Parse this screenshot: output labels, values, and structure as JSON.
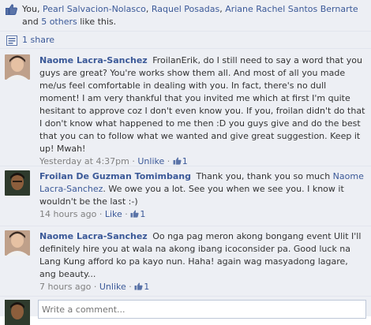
{
  "likes": {
    "prefix": "You, ",
    "name1": "Pearl Salvacion-Nolasco",
    "sep1": ", ",
    "name2": "Raquel Posadas",
    "sep2": ", ",
    "name3": "Ariane Rachel Santos Bernarte",
    "and_text": " and ",
    "others_link": "5 others",
    "suffix": " like this."
  },
  "shares": {
    "label": "1 share"
  },
  "comments": [
    {
      "author": "Naome Lacra-Sanchez",
      "text": "FroilanErik, do I still need to say a word that you guys are great? You're works show them all. And most of all you made me/us feel comfortable in dealing with you. In fact, there's no dull moment! I am very thankful that you invited me which at first I'm quite hesitant to approve coz I don't even know you. If you, froilan didn't do that I don't know what happened to me then :D you guys give and do the best that you can to follow what we wanted and give great suggestion. Keep it up! Mwah!",
      "time": "Yesterday at 4:37pm",
      "action": "Unlike",
      "like_count": "1"
    },
    {
      "author": "Froilan De Guzman Tomimbang",
      "text_pre": "Thank you, thank you so much ",
      "mention": "Naome Lacra-Sanchez",
      "text_post": ". We owe you a lot. See you when we see you. I know it wouldn't be the last :-)",
      "time": "14 hours ago",
      "action": "Like",
      "like_count": "1"
    },
    {
      "author": "Naome Lacra-Sanchez",
      "text": "Oo nga pag meron akong bongang event Ulit I'll definitely hire you at wala na akong ibang icoconsider pa. Good luck na Lang Kung afford ko pa kayo nun. Haha! again wag masyadong lagare, ang beauty...",
      "time": "7 hours ago",
      "action": "Unlike",
      "like_count": "1"
    }
  ],
  "composer": {
    "placeholder": "Write a comment..."
  },
  "colors": {
    "link": "#3b5998",
    "panel_bg": "#edeff4",
    "meta": "#808080"
  },
  "icons": {
    "likes": "thumbs-up-icon",
    "share": "share-icon",
    "comment_like": "mini-thumbs-up-icon"
  }
}
